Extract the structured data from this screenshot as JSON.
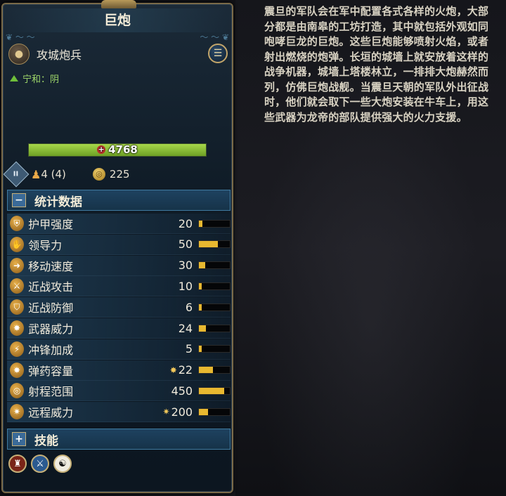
{
  "title": "巨炮",
  "unit_type": {
    "label": "攻城炮兵",
    "icon": "cannon-icon"
  },
  "allegiance": {
    "text": "宁和：阴",
    "color": "#9fd86a"
  },
  "health": {
    "value": "4768",
    "fraction": 1.0
  },
  "summary": {
    "unit_count": "4 (4)",
    "upkeep": "225"
  },
  "stats_section": {
    "label": "统计数据"
  },
  "stats": [
    {
      "label": "护甲强度",
      "value": "20",
      "prefix": "",
      "fill": 0.12,
      "icon": "armor-icon"
    },
    {
      "label": "领导力",
      "value": "50",
      "prefix": "",
      "fill": 0.62,
      "icon": "leadership-icon"
    },
    {
      "label": "移动速度",
      "value": "30",
      "prefix": "",
      "fill": 0.2,
      "icon": "speed-icon"
    },
    {
      "label": "近战攻击",
      "value": "10",
      "prefix": "",
      "fill": 0.1,
      "icon": "melee-attack-icon"
    },
    {
      "label": "近战防御",
      "value": "6",
      "prefix": "",
      "fill": 0.08,
      "icon": "melee-defence-icon"
    },
    {
      "label": "武器威力",
      "value": "24",
      "prefix": "",
      "fill": 0.22,
      "icon": "weapon-strength-icon"
    },
    {
      "label": "冲锋加成",
      "value": "5",
      "prefix": "",
      "fill": 0.08,
      "icon": "charge-bonus-icon"
    },
    {
      "label": "弹药容量",
      "value": "22",
      "prefix": "✸",
      "fill": 0.45,
      "icon": "ammunition-icon"
    },
    {
      "label": "射程范围",
      "value": "450",
      "prefix": "",
      "fill": 0.82,
      "icon": "range-icon"
    },
    {
      "label": "远程威力",
      "value": "200",
      "prefix": "✷",
      "fill": 0.3,
      "icon": "missile-strength-icon"
    }
  ],
  "skills_section": {
    "label": "技能"
  },
  "skills": [
    {
      "icon": "siege-attacker-icon",
      "color": "#7a2418"
    },
    {
      "icon": "fire-damage-icon",
      "color": "#2b5a90"
    },
    {
      "icon": "yin-yang-icon",
      "color": "#f0ece0"
    }
  ],
  "description": "震旦的军队会在军中配置各式各样的火炮，大部分都是由南皋的工坊打造，其中就包括外观如同咆哮巨龙的巨炮。这些巨炮能够喷射火焰，或者射出燃烧的炮弹。长垣的城墙上就安放着这样的战争机器，城墙上塔楼林立，一排排大炮赫然而列，仿佛巨炮战舰。当震旦天朝的军队外出征战时，他们就会取下一些大炮安装在牛车上，用这些武器为龙帝的部队提供强大的火力支援。"
}
